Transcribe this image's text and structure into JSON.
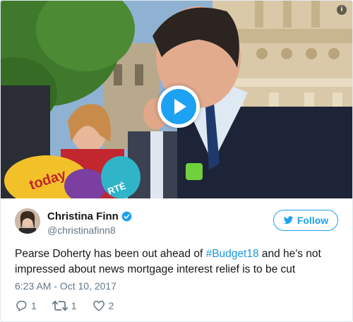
{
  "tweet": {
    "author_name": "Christina Finn",
    "author_handle": "@christinafinn8",
    "follow_label": "Follow",
    "text_before": "Pearse Doherty has been out ahead of ",
    "hashtag": "#Budget18",
    "text_after": " and he's not impressed about news mortgage interest relief is to be cut",
    "timestamp": "6:23 AM - Oct 10, 2017",
    "reply_count": "1",
    "retweet_count": "1",
    "like_count": "2"
  },
  "media": {
    "info_label": "i",
    "mic_brand": "RTÉ",
    "mic_text": "today"
  },
  "icons": {
    "play": "play-icon",
    "info": "info-icon",
    "verified": "verified-badge-icon",
    "follow": "twitter-bird-icon",
    "reply": "reply-icon",
    "retweet": "retweet-icon",
    "like": "heart-icon"
  },
  "colors": {
    "accent": "#1da1f2",
    "hashtag": "#1b95e0",
    "secondary_text": "#657786"
  }
}
